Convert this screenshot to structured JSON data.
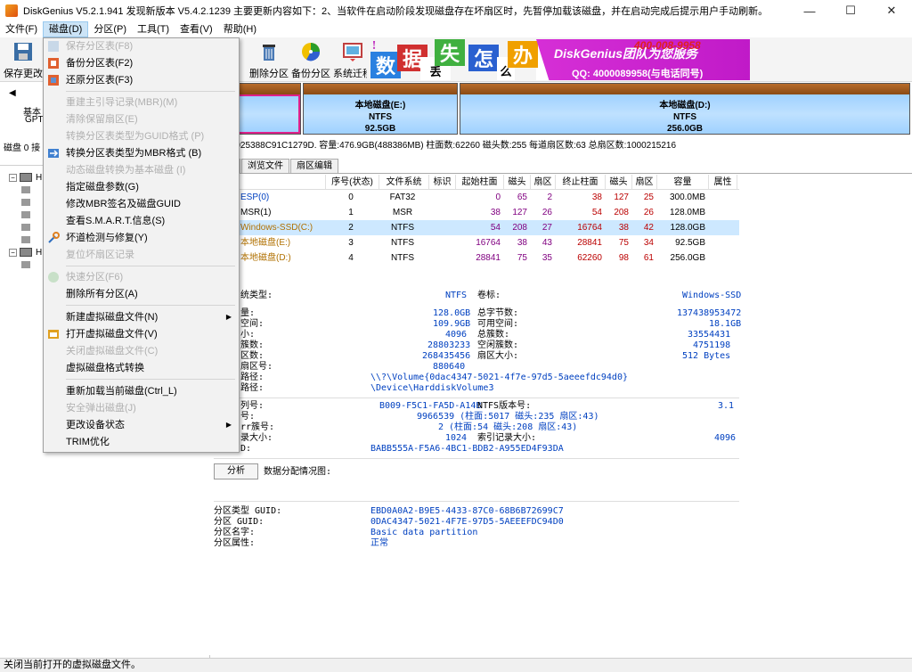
{
  "window": {
    "title": "DiskGenius V5.2.1.941  发现新版本 V5.4.2.1239 主要更新内容如下：2、当软件在启动阶段发现磁盘存在坏扇区时，先暂停加载该磁盘，并在启动完成后提示用户手动刷新。",
    "min": "—",
    "max": "☐",
    "close": "✕"
  },
  "menubar": [
    "文件(F)",
    "磁盘(D)",
    "分区(P)",
    "工具(T)",
    "查看(V)",
    "帮助(H)"
  ],
  "toolbar": {
    "save": "保存更改",
    "delete": "删除分区",
    "backup": "备份分区",
    "migrate": "系统迁移"
  },
  "banner": {
    "chars": [
      "数",
      "据",
      "丢",
      "失",
      "怎",
      "么",
      "办"
    ],
    "title": "DiskGenius团队为您服务",
    "phone": "400-008-9958",
    "qq": "QQ: 4000089958(与电话同号)",
    "bang": "!"
  },
  "left": {
    "disk_type": "基本",
    "gpt": "GPT",
    "disk_line": "磁盘 0 接",
    "tree_h": "H"
  },
  "diskmap": [
    {
      "name": "本地磁盘(E:)",
      "fs": "NTFS",
      "size": "92.5GB"
    },
    {
      "name": "本地磁盘(D:)",
      "fs": "NTFS",
      "size": "256.0GB"
    }
  ],
  "serial": "列号:0025388C91C1279D.   容量:476.9GB(488386MB)   柱面数:62260   磁头数:255   每道扇区数:63   总扇区数:1000215216",
  "tabs": [
    "分区参数",
    "浏览文件",
    "扇区编辑"
  ],
  "tab_prefix": "参数",
  "table": {
    "headers": [
      "",
      "序号(状态)",
      "文件系统",
      "标识",
      "起始柱面",
      "磁头",
      "扇区",
      "终止柱面",
      "磁头",
      "扇区",
      "容量",
      "属性"
    ],
    "rows": [
      [
        "ESP(0)",
        "0",
        "FAT32",
        "",
        "0",
        "65",
        "2",
        "38",
        "127",
        "25",
        "300.0MB",
        ""
      ],
      [
        "MSR(1)",
        "1",
        "MSR",
        "",
        "38",
        "127",
        "26",
        "54",
        "208",
        "26",
        "128.0MB",
        ""
      ],
      [
        "Windows-SSD(C:)",
        "2",
        "NTFS",
        "",
        "54",
        "208",
        "27",
        "16764",
        "38",
        "42",
        "128.0GB",
        ""
      ],
      [
        "本地磁盘(E:)",
        "3",
        "NTFS",
        "",
        "16764",
        "38",
        "43",
        "28841",
        "75",
        "34",
        "92.5GB",
        ""
      ],
      [
        "本地磁盘(D:)",
        "4",
        "NTFS",
        "",
        "28841",
        "75",
        "35",
        "62260",
        "98",
        "61",
        "256.0GB",
        ""
      ]
    ]
  },
  "details": {
    "fs_type_label": "统类型:",
    "fs_type": "NTFS",
    "vol_label": "卷标:",
    "vol": "Windows-SSD",
    "l1": "量:",
    "v1": "128.0GB",
    "l1b": "总字节数:",
    "v1b": "137438953472",
    "l2": "空间:",
    "v2": "109.9GB",
    "l2b": "可用空间:",
    "v2b": "18.1GB",
    "l3": "小:",
    "v3": "4096",
    "l3b": "总簇数:",
    "v3b": "33554431",
    "l4": "簇数:",
    "v4": "28803233",
    "l4b": "空闲簇数:",
    "v4b": "4751198",
    "l5": "区数:",
    "v5": "268435456",
    "l5b": "扇区大小:",
    "v5b": "512 Bytes",
    "l6": "扇区号:",
    "v6": "880640",
    "l7": "路径:",
    "v7": "\\\\?\\Volume{0dac4347-5021-4f7e-97d5-5aeeefdc94d0}",
    "l8": "路径:",
    "v8": "\\Device\\HarddiskVolume3",
    "l9": "列号:",
    "v9": "B009-F5C1-FA5D-A14B",
    "l9b": "NTFS版本号:",
    "v9b": "3.1",
    "l10": "号:",
    "v10": "9966539 (柱面:5017 磁头:235 扇区:43)",
    "l11": "rr簇号:",
    "v11": "2 (柱面:54 磁头:208 扇区:43)",
    "l12": "录大小:",
    "v12": "1024",
    "l12b": "索引记录大小:",
    "v12b": "4096",
    "l13": "D:",
    "v13": "BABB555A-F5A6-4BC1-BDB2-A955ED4F93DA",
    "analyze": "分析",
    "dist": "数据分配情况图:",
    "g1l": "分区类型 GUID:",
    "g1": "EBD0A0A2-B9E5-4433-87C0-68B6B72699C7",
    "g2l": "分区 GUID:",
    "g2": "0DAC4347-5021-4F7E-97D5-5AEEEFDC94D0",
    "g3l": "分区名字:",
    "g3": "Basic data partition",
    "g4l": "分区属性:",
    "g4": "正常"
  },
  "dropdown": [
    {
      "label": "保存分区表(F8)",
      "dis": true
    },
    {
      "label": "备份分区表(F2)",
      "dis": false
    },
    {
      "label": "还原分区表(F3)",
      "dis": false
    },
    {
      "label": "重建主引导记录(MBR)(M)",
      "dis": true
    },
    {
      "label": "清除保留扇区(E)",
      "dis": true
    },
    {
      "label": "转换分区表类型为GUID格式 (P)",
      "dis": true
    },
    {
      "label": "转换分区表类型为MBR格式 (B)",
      "dis": false
    },
    {
      "label": "动态磁盘转换为基本磁盘 (I)",
      "dis": true
    },
    {
      "label": "指定磁盘参数(G)",
      "dis": false
    },
    {
      "label": "修改MBR签名及磁盘GUID",
      "dis": false
    },
    {
      "label": "查看S.M.A.R.T.信息(S)",
      "dis": false
    },
    {
      "label": "坏道检测与修复(Y)",
      "dis": false
    },
    {
      "label": "复位坏扇区记录",
      "dis": true
    },
    {
      "label": "快速分区(F6)",
      "dis": true
    },
    {
      "label": "删除所有分区(A)",
      "dis": false
    },
    {
      "label": "新建虚拟磁盘文件(N)",
      "dis": false
    },
    {
      "label": "打开虚拟磁盘文件(V)",
      "dis": false
    },
    {
      "label": "关闭虚拟磁盘文件(C)",
      "dis": true
    },
    {
      "label": "虚拟磁盘格式转换",
      "dis": false
    },
    {
      "label": "重新加载当前磁盘(Ctrl_L)",
      "dis": false
    },
    {
      "label": "安全弹出磁盘(J)",
      "dis": true
    },
    {
      "label": "更改设备状态",
      "dis": false
    },
    {
      "label": "TRIM优化",
      "dis": false
    }
  ],
  "submenu_arrow": "▶",
  "status": "关闭当前打开的虚拟磁盘文件。"
}
